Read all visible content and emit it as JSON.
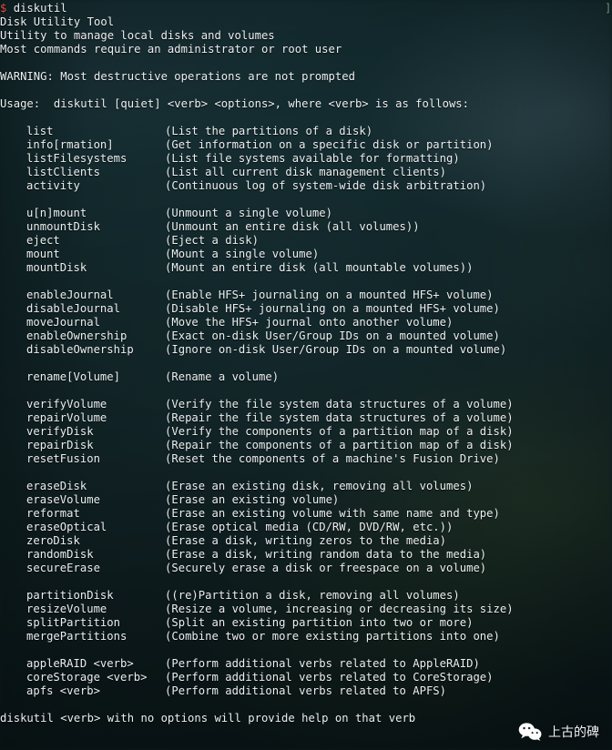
{
  "terminal": {
    "prompt_sigil": "$",
    "prompt_command": "diskutil",
    "right_bracket": "]",
    "header_lines": [
      "Disk Utility Tool",
      "Utility to manage local disks and volumes",
      "Most commands require an administrator or root user"
    ],
    "warning_line": "WARNING: Most destructive operations are not prompted",
    "usage_line": "Usage:  diskutil [quiet] <verb> <options>, where <verb> is as follows:",
    "footer_line": "diskutil <verb> with no options will provide help on that verb",
    "colors": {
      "background": "#13282b",
      "foreground": "#eceff1",
      "prompt_sigil": "#e0503a",
      "bracket": "#5f9e7a"
    },
    "groups": [
      {
        "entries": [
          {
            "verb": "list",
            "desc": "(List the partitions of a disk)"
          },
          {
            "verb": "info[rmation]",
            "desc": "(Get information on a specific disk or partition)"
          },
          {
            "verb": "listFilesystems",
            "desc": "(List file systems available for formatting)"
          },
          {
            "verb": "listClients",
            "desc": "(List all current disk management clients)"
          },
          {
            "verb": "activity",
            "desc": "(Continuous log of system-wide disk arbitration)"
          }
        ]
      },
      {
        "entries": [
          {
            "verb": "u[n]mount",
            "desc": "(Unmount a single volume)"
          },
          {
            "verb": "unmountDisk",
            "desc": "(Unmount an entire disk (all volumes))"
          },
          {
            "verb": "eject",
            "desc": "(Eject a disk)"
          },
          {
            "verb": "mount",
            "desc": "(Mount a single volume)"
          },
          {
            "verb": "mountDisk",
            "desc": "(Mount an entire disk (all mountable volumes))"
          }
        ]
      },
      {
        "entries": [
          {
            "verb": "enableJournal",
            "desc": "(Enable HFS+ journaling on a mounted HFS+ volume)"
          },
          {
            "verb": "disableJournal",
            "desc": "(Disable HFS+ journaling on a mounted HFS+ volume)"
          },
          {
            "verb": "moveJournal",
            "desc": "(Move the HFS+ journal onto another volume)"
          },
          {
            "verb": "enableOwnership",
            "desc": "(Exact on-disk User/Group IDs on a mounted volume)"
          },
          {
            "verb": "disableOwnership",
            "desc": "(Ignore on-disk User/Group IDs on a mounted volume)"
          }
        ]
      },
      {
        "entries": [
          {
            "verb": "rename[Volume]",
            "desc": "(Rename a volume)"
          }
        ]
      },
      {
        "entries": [
          {
            "verb": "verifyVolume",
            "desc": "(Verify the file system data structures of a volume)"
          },
          {
            "verb": "repairVolume",
            "desc": "(Repair the file system data structures of a volume)"
          },
          {
            "verb": "verifyDisk",
            "desc": "(Verify the components of a partition map of a disk)"
          },
          {
            "verb": "repairDisk",
            "desc": "(Repair the components of a partition map of a disk)"
          },
          {
            "verb": "resetFusion",
            "desc": "(Reset the components of a machine's Fusion Drive)"
          }
        ]
      },
      {
        "entries": [
          {
            "verb": "eraseDisk",
            "desc": "(Erase an existing disk, removing all volumes)"
          },
          {
            "verb": "eraseVolume",
            "desc": "(Erase an existing volume)"
          },
          {
            "verb": "reformat",
            "desc": "(Erase an existing volume with same name and type)"
          },
          {
            "verb": "eraseOptical",
            "desc": "(Erase optical media (CD/RW, DVD/RW, etc.))"
          },
          {
            "verb": "zeroDisk",
            "desc": "(Erase a disk, writing zeros to the media)"
          },
          {
            "verb": "randomDisk",
            "desc": "(Erase a disk, writing random data to the media)"
          },
          {
            "verb": "secureErase",
            "desc": "(Securely erase a disk or freespace on a volume)"
          }
        ]
      },
      {
        "entries": [
          {
            "verb": "partitionDisk",
            "desc": "((re)Partition a disk, removing all volumes)"
          },
          {
            "verb": "resizeVolume",
            "desc": "(Resize a volume, increasing or decreasing its size)"
          },
          {
            "verb": "splitPartition",
            "desc": "(Split an existing partition into two or more)"
          },
          {
            "verb": "mergePartitions",
            "desc": "(Combine two or more existing partitions into one)"
          }
        ]
      },
      {
        "entries": [
          {
            "verb": "appleRAID <verb>",
            "desc": "(Perform additional verbs related to AppleRAID)"
          },
          {
            "verb": "coreStorage <verb>",
            "desc": "(Perform additional verbs related to CoreStorage)"
          },
          {
            "verb": "apfs <verb>",
            "desc": "(Perform additional verbs related to APFS)"
          }
        ]
      }
    ]
  },
  "watermark": {
    "icon": "wechat-icon",
    "label": "上古的碑"
  }
}
